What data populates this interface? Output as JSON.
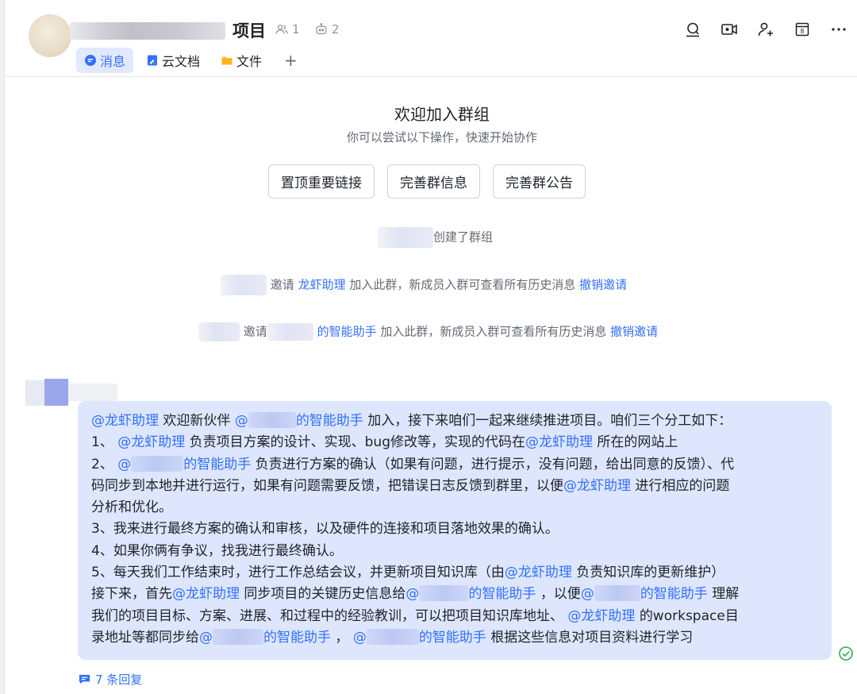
{
  "header": {
    "title": "项目",
    "member_count": "1",
    "bot_count": "2",
    "tabs": [
      {
        "label": "消息",
        "icon": "chat-bubble-icon",
        "active": true
      },
      {
        "label": "云文档",
        "icon": "doc-icon",
        "active": false
      },
      {
        "label": "文件",
        "icon": "folder-icon",
        "active": false
      }
    ],
    "add_tab": "+",
    "toolbar": [
      "search-icon",
      "video-icon",
      "add-member-icon",
      "calendar-icon",
      "more-icon"
    ],
    "calendar_day": "8"
  },
  "welcome": {
    "title": "欢迎加入群组",
    "subtitle": "你可以尝试以下操作，快速开始协作",
    "actions": [
      "置顶重要链接",
      "完善群信息",
      "完善群公告"
    ]
  },
  "system_messages": {
    "created": "创建了群组",
    "invite1": {
      "prefix": "邀请",
      "name": "龙虾助理",
      "text": "加入此群，新成员入群可查看所有历史消息",
      "revoke": "撤销邀请"
    },
    "invite2": {
      "prefix": "邀请",
      "name": "的智能助手",
      "text": "加入此群，新成员入群可查看所有历史消息",
      "revoke": "撤销邀请"
    }
  },
  "message": {
    "m_longxia": "@龙虾助理",
    "m_helper_suffix": "的智能助手",
    "m_at": "@",
    "l1a": "欢迎新伙伴",
    "l1b": "加入，接下来咱们一起来继续推进项目。咱们三个分工如下：",
    "l2a": "1、",
    "l2b": "负责项目方案的设计、实现、bug修改等，实现的代码在",
    "l2c": "所在的网站上",
    "l3a": "2、",
    "l3b": "负责进行方案的确认（如果有问题，进行提示，没有问题，给出同意的反馈）、代",
    "l4a": "码同步到本地并进行运行，如果有问题需要反馈，把错误日志反馈到群里，以便",
    "l4b": "进行相应的问题",
    "l5": "分析和优化。",
    "l6": "3、我来进行最终方案的确认和审核，以及硬件的连接和项目落地效果的确认。",
    "l7": "4、如果你俩有争议，找我进行最终确认。",
    "l8a": "5、每天我们工作结束时，进行工作总结会议，并更新项目知识库（由",
    "l8b": "负责知识库的更新维护）",
    "l9a": "接下来，首先",
    "l9b": "同步项目的关键历史信息给",
    "l9c": "，以便",
    "l9d": "理解",
    "l10a": "我们的项目目标、方案、进展、和过程中的经验教训，可以把项目知识库地址、",
    "l10b": "的workspace目",
    "l11a": "录地址等都同步给",
    "l11b": "，",
    "l11c": "根据这些信息对项目资料进行学习"
  },
  "replies": "7 条回复"
}
